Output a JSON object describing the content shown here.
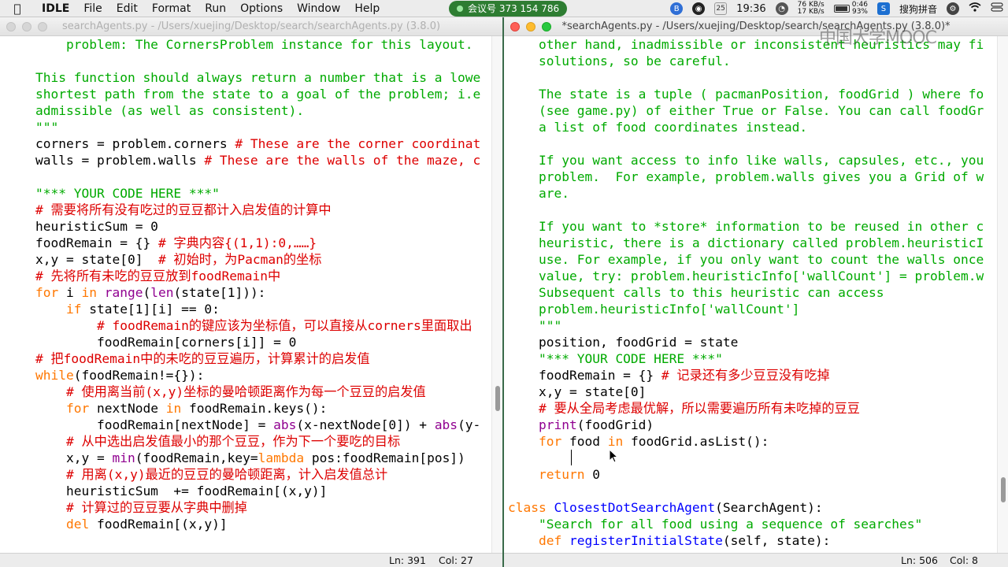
{
  "menubar": {
    "app": "IDLE",
    "items": [
      "File",
      "Edit",
      "Format",
      "Run",
      "Options",
      "Window",
      "Help"
    ],
    "meeting": "会议号 373 154 786",
    "status": {
      "calendar_day": "25",
      "time": "19:36",
      "net_up": "76 KB/s",
      "net_down": "17 KB/s",
      "battery_time": "0:46",
      "battery_pct": "93%",
      "ime": "搜狗拼音"
    }
  },
  "left_window": {
    "title": "searchAgents.py - /Users/xuejing/Desktop/search/searchAgents.py (3.8.0)",
    "status": {
      "ln": "Ln: 391",
      "col": "Col: 27"
    },
    "lines": [
      [
        [
          "",
          "    "
        ],
        [
          "str",
          "problem: The CornersProblem instance for this layout."
        ]
      ],
      [
        [
          "",
          ""
        ]
      ],
      [
        [
          "str",
          "This function should always return a number that is a lowe"
        ]
      ],
      [
        [
          "str",
          "shortest path from the state to a goal of the problem; i.e"
        ]
      ],
      [
        [
          "str",
          "admissible (as well as consistent)."
        ]
      ],
      [
        [
          "str",
          "\"\"\""
        ]
      ],
      [
        [
          "",
          "corners = problem.corners "
        ],
        [
          "cmt",
          "# These are the corner coordinat"
        ]
      ],
      [
        [
          "",
          "walls = problem.walls "
        ],
        [
          "cmt",
          "# These are the walls of the maze, c"
        ]
      ],
      [
        [
          "",
          ""
        ]
      ],
      [
        [
          "str",
          "\"*** YOUR CODE HERE ***\""
        ]
      ],
      [
        [
          "cmt",
          "# 需要将所有没有吃过的豆豆都计入启发值的计算中"
        ]
      ],
      [
        [
          "",
          "heuristicSum = 0"
        ]
      ],
      [
        [
          "",
          "foodRemain = {} "
        ],
        [
          "cmt",
          "# 字典内容{(1,1):0,……}"
        ]
      ],
      [
        [
          "",
          "x,y = state[0]  "
        ],
        [
          "cmt",
          "# 初始时，为Pacman的坐标"
        ]
      ],
      [
        [
          "cmt",
          "# 先将所有未吃的豆豆放到foodRemain中"
        ]
      ],
      [
        [
          "kw",
          "for"
        ],
        [
          "",
          " i "
        ],
        [
          "kw",
          "in"
        ],
        [
          "",
          " "
        ],
        [
          "bi",
          "range"
        ],
        [
          "",
          "("
        ],
        [
          "bi",
          "len"
        ],
        [
          "",
          "(state[1])):"
        ]
      ],
      [
        [
          "",
          "    "
        ],
        [
          "kw",
          "if"
        ],
        [
          "",
          " state[1][i] == 0:"
        ]
      ],
      [
        [
          "",
          "        "
        ],
        [
          "cmt",
          "# foodRemain的键应该为坐标值，可以直接从corners里面取出"
        ]
      ],
      [
        [
          "",
          "        foodRemain[corners[i]] = 0"
        ]
      ],
      [
        [
          "cmt",
          "# 把foodRemain中的未吃的豆豆遍历，计算累计的启发值"
        ]
      ],
      [
        [
          "kw",
          "while"
        ],
        [
          "",
          "(foodRemain!={}):"
        ]
      ],
      [
        [
          "",
          "    "
        ],
        [
          "cmt",
          "# 使用离当前(x,y)坐标的曼哈顿距离作为每一个豆豆的启发值"
        ]
      ],
      [
        [
          "",
          "    "
        ],
        [
          "kw",
          "for"
        ],
        [
          "",
          " nextNode "
        ],
        [
          "kw",
          "in"
        ],
        [
          "",
          " foodRemain.keys():"
        ]
      ],
      [
        [
          "",
          "        foodRemain[nextNode] = "
        ],
        [
          "bi",
          "abs"
        ],
        [
          "",
          "(x-nextNode[0]) + "
        ],
        [
          "bi",
          "abs"
        ],
        [
          "",
          "(y-"
        ]
      ],
      [
        [
          "",
          "    "
        ],
        [
          "cmt",
          "# 从中选出启发值最小的那个豆豆，作为下一个要吃的目标"
        ]
      ],
      [
        [
          "",
          "    x,y = "
        ],
        [
          "bi",
          "min"
        ],
        [
          "",
          "(foodRemain,key="
        ],
        [
          "kw",
          "lambda"
        ],
        [
          "",
          " pos:foodRemain[pos])"
        ]
      ],
      [
        [
          "",
          "    "
        ],
        [
          "cmt",
          "# 用离(x,y)最近的豆豆的曼哈顿距离，计入启发值总计"
        ]
      ],
      [
        [
          "",
          "    heuristicSum  += foodRemain[(x,y)]"
        ]
      ],
      [
        [
          "",
          "    "
        ],
        [
          "cmt",
          "# 计算过的豆豆要从字典中删掉"
        ]
      ],
      [
        [
          "",
          "    "
        ],
        [
          "kw",
          "del"
        ],
        [
          "",
          " foodRemain[(x,y)]"
        ]
      ]
    ]
  },
  "right_window": {
    "title": "*searchAgents.py - /Users/xuejing/Desktop/search/searchAgents.py (3.8.0)*",
    "status": {
      "ln": "Ln: 506",
      "col": "Col: 8"
    },
    "lines": [
      [
        [
          "",
          "    "
        ],
        [
          "str",
          "other hand, inadmissible or inconsistent heuristics may fi"
        ]
      ],
      [
        [
          "",
          "    "
        ],
        [
          "str",
          "solutions, so be careful."
        ]
      ],
      [
        [
          "",
          ""
        ]
      ],
      [
        [
          "",
          "    "
        ],
        [
          "str",
          "The state is a tuple ( pacmanPosition, foodGrid ) where fo"
        ]
      ],
      [
        [
          "",
          "    "
        ],
        [
          "str",
          "(see game.py) of either True or False. You can call foodGr"
        ]
      ],
      [
        [
          "",
          "    "
        ],
        [
          "str",
          "a list of food coordinates instead."
        ]
      ],
      [
        [
          "",
          ""
        ]
      ],
      [
        [
          "",
          "    "
        ],
        [
          "str",
          "If you want access to info like walls, capsules, etc., you"
        ]
      ],
      [
        [
          "",
          "    "
        ],
        [
          "str",
          "problem.  For example, problem.walls gives you a Grid of w"
        ]
      ],
      [
        [
          "",
          "    "
        ],
        [
          "str",
          "are."
        ]
      ],
      [
        [
          "",
          ""
        ]
      ],
      [
        [
          "",
          "    "
        ],
        [
          "str",
          "If you want to *store* information to be reused in other c"
        ]
      ],
      [
        [
          "",
          "    "
        ],
        [
          "str",
          "heuristic, there is a dictionary called problem.heuristicI"
        ]
      ],
      [
        [
          "",
          "    "
        ],
        [
          "str",
          "use. For example, if you only want to count the walls once"
        ]
      ],
      [
        [
          "",
          "    "
        ],
        [
          "str",
          "value, try: problem.heuristicInfo['wallCount'] = problem.w"
        ]
      ],
      [
        [
          "",
          "    "
        ],
        [
          "str",
          "Subsequent calls to this heuristic can access"
        ]
      ],
      [
        [
          "",
          "    "
        ],
        [
          "str",
          "problem.heuristicInfo['wallCount']"
        ]
      ],
      [
        [
          "",
          "    "
        ],
        [
          "str",
          "\"\"\""
        ]
      ],
      [
        [
          "",
          "    position, foodGrid = state"
        ]
      ],
      [
        [
          "",
          "    "
        ],
        [
          "str",
          "\"*** YOUR CODE HERE ***\""
        ]
      ],
      [
        [
          "",
          "    foodRemain = {} "
        ],
        [
          "cmt",
          "# 记录还有多少豆豆没有吃掉"
        ]
      ],
      [
        [
          "",
          "    x,y = state[0]"
        ]
      ],
      [
        [
          "",
          "    "
        ],
        [
          "cmt",
          "# 要从全局考虑最优解，所以需要遍历所有未吃掉的豆豆"
        ]
      ],
      [
        [
          "",
          "    "
        ],
        [
          "bi",
          "print"
        ],
        [
          "",
          "(foodGrid)"
        ]
      ],
      [
        [
          "",
          "    "
        ],
        [
          "kw",
          "for"
        ],
        [
          "",
          " food "
        ],
        [
          "kw",
          "in"
        ],
        [
          "",
          " foodGrid.asList():"
        ]
      ],
      [
        [
          "",
          "        "
        ]
      ],
      [
        [
          "",
          "    "
        ],
        [
          "kw",
          "return"
        ],
        [
          "",
          " 0"
        ]
      ],
      [
        [
          "",
          ""
        ]
      ],
      [
        [
          "kw",
          "class"
        ],
        [
          "",
          " "
        ],
        [
          "df",
          "ClosestDotSearchAgent"
        ],
        [
          "",
          "(SearchAgent):"
        ]
      ],
      [
        [
          "",
          "    "
        ],
        [
          "str",
          "\"Search for all food using a sequence of searches\""
        ]
      ],
      [
        [
          "",
          "    "
        ],
        [
          "kw",
          "def"
        ],
        [
          "",
          " "
        ],
        [
          "df",
          "registerInitialState"
        ],
        [
          "",
          "(self, state):"
        ]
      ]
    ]
  },
  "watermark": "中国大学MOOC",
  "colors": {
    "string": "#00aa00",
    "comment": "#dd0000",
    "keyword": "#ff7700",
    "builtin": "#900090",
    "definition": "#0000ff"
  }
}
